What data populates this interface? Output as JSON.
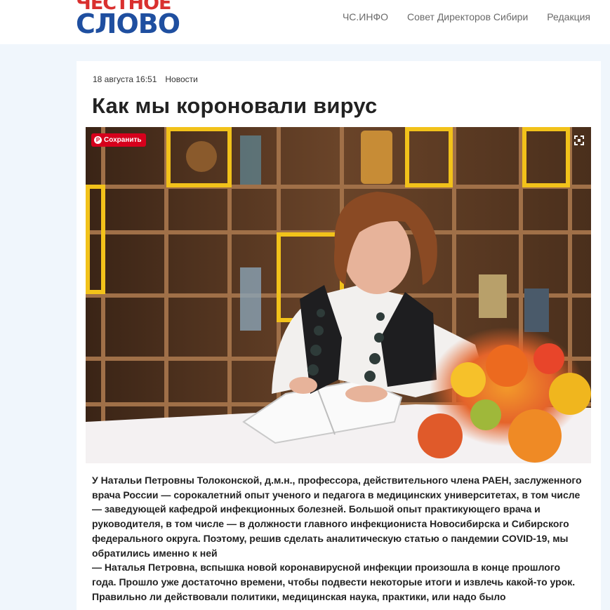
{
  "header": {
    "logo_line1": "ЧЕСТНОЕ",
    "logo_line2": "СЛОВО",
    "nav": [
      {
        "label": "ЧС.ИНФО"
      },
      {
        "label": "Совет Директоров Сибири"
      },
      {
        "label": "Редакция"
      }
    ]
  },
  "article": {
    "date": "18 августа 16:51",
    "category": "Новости",
    "title": "Как мы короновали вирус",
    "pin_label": "Сохранить",
    "paragraphs": [
      "У Натальи Петровны Толоконской, д.м.н., профессора, действительного члена РАЕН, заслуженного врача России — сорокалетний опыт ученого и педагога в медицинских университетах, в том числе — заведующей кафедрой инфекционных болезней. Большой опыт практикующего врача и руководителя, в том числе — в должности главного инфекциониста Новосибирска и Сибирского федерального округа. Поэтому, решив сделать аналитическую статью о пандемии COVID-19, мы обратились именно к ней",
      "— Наталья Петровна, вспышка новой коронавирусной инфекции произошла в конце прошлого года. Прошло уже достаточно времени, чтобы подвести некоторые итоги и извлечь какой-то урок. Правильно ли действовали политики, медицинская наука, практики, или надо было"
    ]
  },
  "colors": {
    "logo_red": "#d9302f",
    "logo_blue": "#1f4fa0",
    "pinterest_red": "#d6001c",
    "page_bg": "#f0f6fc"
  }
}
